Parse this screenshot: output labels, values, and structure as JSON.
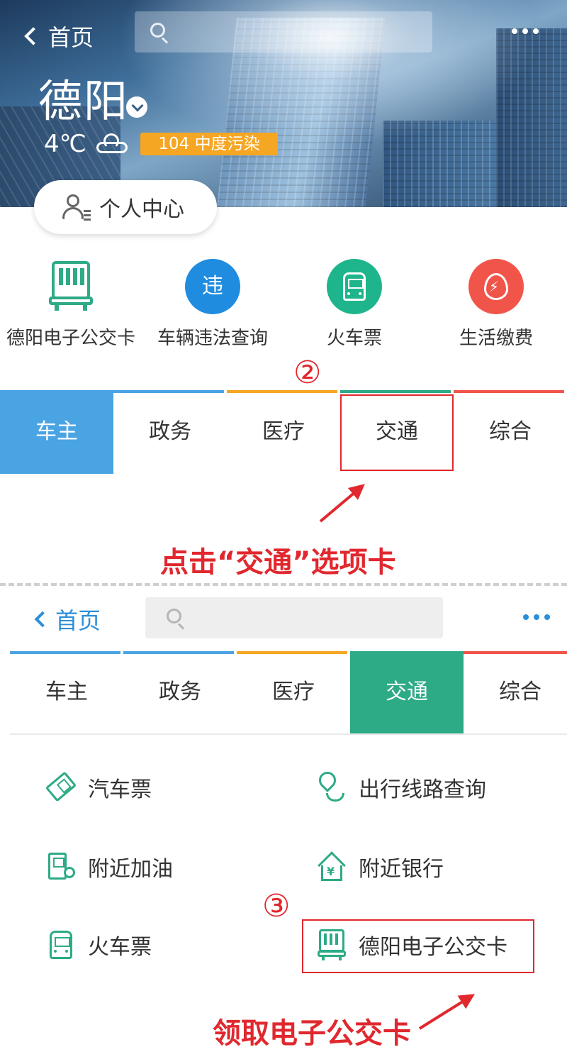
{
  "colors": {
    "blue_tab": "#4aa3e3",
    "green_tab": "#2daa86",
    "accent_red": "#e0282e",
    "aqi_orange": "#f5a623",
    "violation_blue": "#1f8ce0",
    "train_green": "#1fb58c",
    "bill_red": "#f1554a"
  },
  "header": {
    "back_label": "首页",
    "search_placeholder": "",
    "more_icon": "more-icon"
  },
  "weather": {
    "city": "德阳",
    "temperature": "4℃",
    "aqi": "104 中度污染",
    "icon": "cloud-icon"
  },
  "profile": {
    "label": "个人中心",
    "icon": "user-icon"
  },
  "quick_services": [
    {
      "label": "德阳电子公交卡",
      "icon": "bus-card-icon"
    },
    {
      "label": "车辆违法查询",
      "icon": "violation-icon",
      "glyph": "违"
    },
    {
      "label": "火车票",
      "icon": "train-icon"
    },
    {
      "label": "生活缴费",
      "icon": "bill-payment-icon"
    }
  ],
  "tabs_a": [
    "车主",
    "政务",
    "医疗",
    "交通",
    "综合"
  ],
  "tabs_a_active": "车主",
  "annotations": {
    "step2": "②",
    "step2_note": "点击“交通”选项卡",
    "step3": "③",
    "step3_note": "领取电子公交卡"
  },
  "screen_b": {
    "back_label": "首页",
    "search_placeholder": "",
    "tabs": [
      "车主",
      "政务",
      "医疗",
      "交通",
      "综合"
    ],
    "active_tab": "交通",
    "services": [
      {
        "label": "汽车票",
        "icon": "bus-ticket-icon"
      },
      {
        "label": "出行线路查询",
        "icon": "route-search-icon"
      },
      {
        "label": "附近加油",
        "icon": "gas-station-icon"
      },
      {
        "label": "附近银行",
        "icon": "bank-icon"
      },
      {
        "label": "火车票",
        "icon": "train-icon"
      },
      {
        "label": "德阳电子公交卡",
        "icon": "bus-card-icon"
      }
    ]
  }
}
